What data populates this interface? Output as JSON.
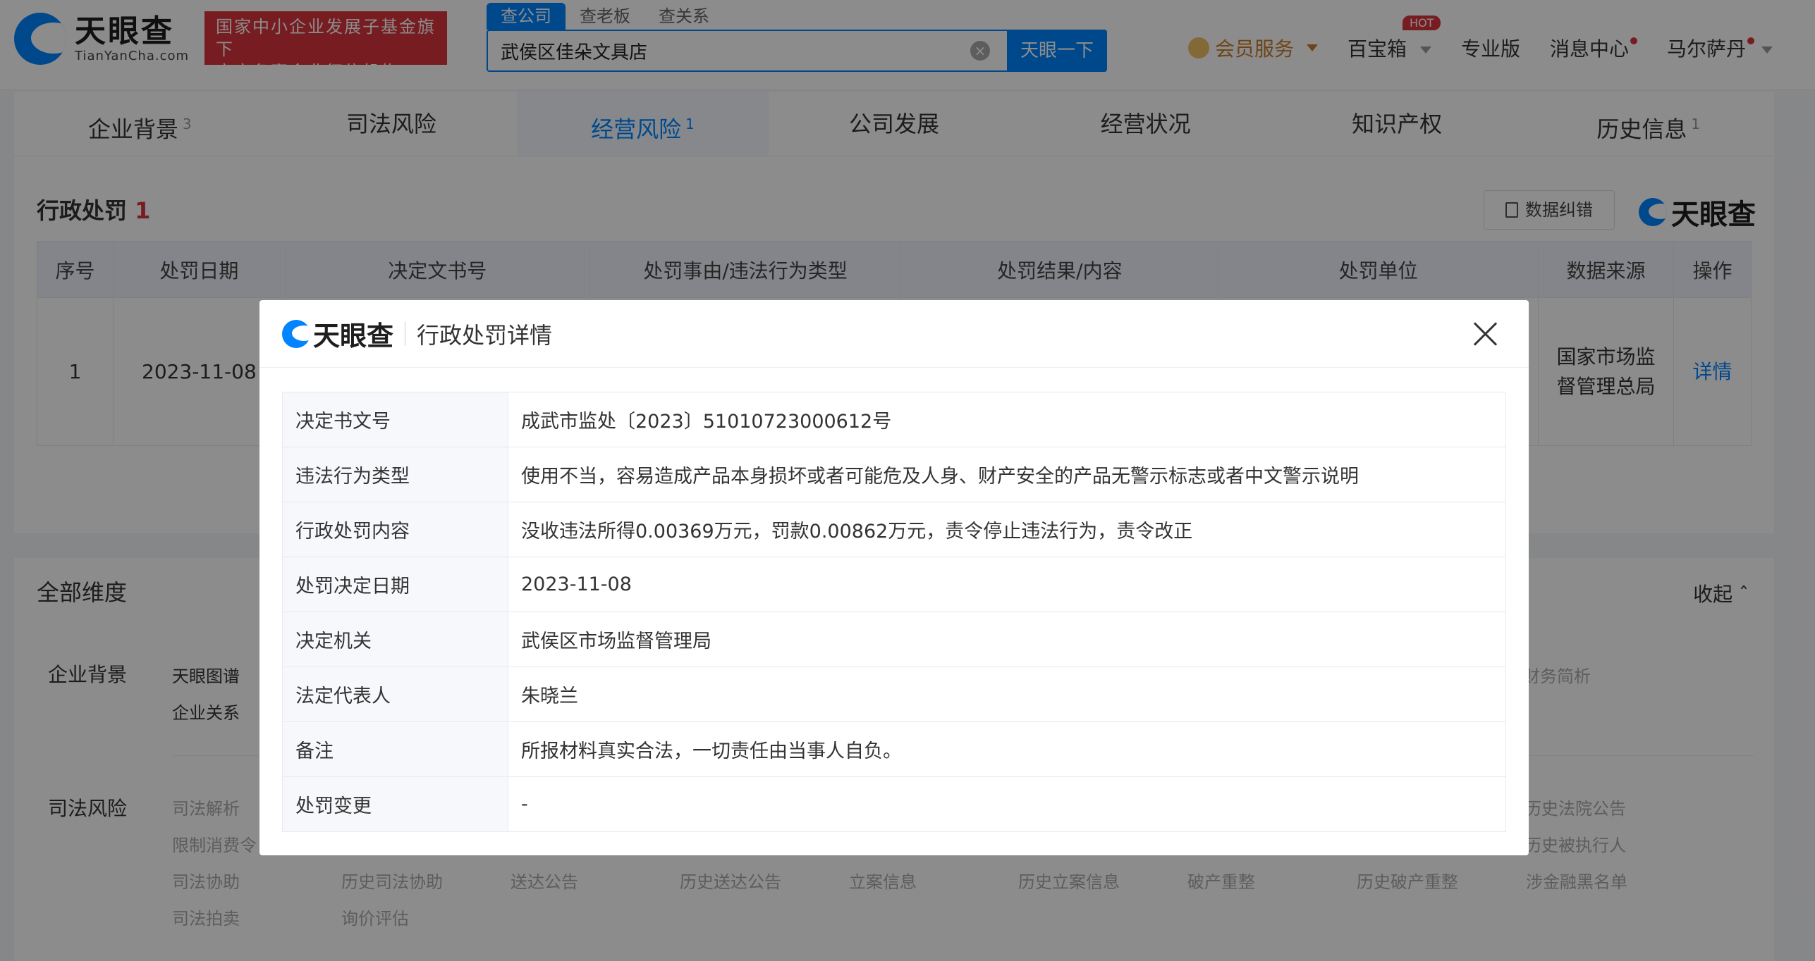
{
  "header": {
    "logo_cn": "天眼查",
    "logo_en": "TianYanCha.com",
    "official_l1": "国家中小企业发展子基金旗下",
    "official_l2": "官方备案企业征信机构",
    "search_tabs": [
      "查公司",
      "查老板",
      "查关系"
    ],
    "search_value": "武侯区佳朵文具店",
    "search_button": "天眼一下",
    "nav": {
      "vip": "会员服务",
      "box": "百宝箱",
      "hot": "HOT",
      "pro": "专业版",
      "msg": "消息中心",
      "user": "马尔萨丹"
    }
  },
  "tabs": [
    {
      "label": "企业背景",
      "count": "3"
    },
    {
      "label": "司法风险",
      "count": ""
    },
    {
      "label": "经营风险",
      "count": "1"
    },
    {
      "label": "公司发展",
      "count": ""
    },
    {
      "label": "经营状况",
      "count": ""
    },
    {
      "label": "知识产权",
      "count": ""
    },
    {
      "label": "历史信息",
      "count": "1"
    }
  ],
  "penalty": {
    "title": "行政处罚",
    "count": "1",
    "fix_button": "数据纠错",
    "watermark": "天眼查",
    "columns": [
      "序号",
      "处罚日期",
      "决定文书号",
      "处罚事由/违法行为类型",
      "处罚结果/内容",
      "处罚单位",
      "数据来源",
      "操作"
    ],
    "row": {
      "no": "1",
      "date": "2023-11-08",
      "source_l1": "国家市场监",
      "source_l2": "督管理总局",
      "action": "详情"
    }
  },
  "dims": {
    "title": "全部维度",
    "collapse": "收起",
    "bg_label": "企业背景",
    "bg_items": [
      "天眼图谱",
      "企业关系",
      "财务简析"
    ],
    "jud_label": "司法风险",
    "jud_items": [
      "司法解析",
      "限制消费令",
      "历史法院公告",
      "历史被执行人",
      "司法协助",
      "历史司法协助",
      "送达公告",
      "历史送达公告",
      "立案信息",
      "历史立案信息",
      "破产重整",
      "历史破产重整",
      "涉金融黑名单",
      "司法拍卖",
      "询价评估"
    ]
  },
  "modal": {
    "logo": "天眼查",
    "title": "行政处罚详情",
    "rows": [
      {
        "k": "决定书文号",
        "v": "成武市监处〔2023〕51010723000612号"
      },
      {
        "k": "违法行为类型",
        "v": "使用不当，容易造成产品本身损坏或者可能危及人身、财产安全的产品无警示标志或者中文警示说明"
      },
      {
        "k": "行政处罚内容",
        "v": "没收违法所得0.00369万元，罚款0.00862万元，责令停止违法行为，责令改正"
      },
      {
        "k": "处罚决定日期",
        "v": "2023-11-08"
      },
      {
        "k": "决定机关",
        "v": "武侯区市场监督管理局"
      },
      {
        "k": "法定代表人",
        "v": "朱晓兰"
      },
      {
        "k": "备注",
        "v": "所报材料真实合法，一切责任由当事人自负。"
      },
      {
        "k": "处罚变更",
        "v": "-"
      }
    ]
  }
}
